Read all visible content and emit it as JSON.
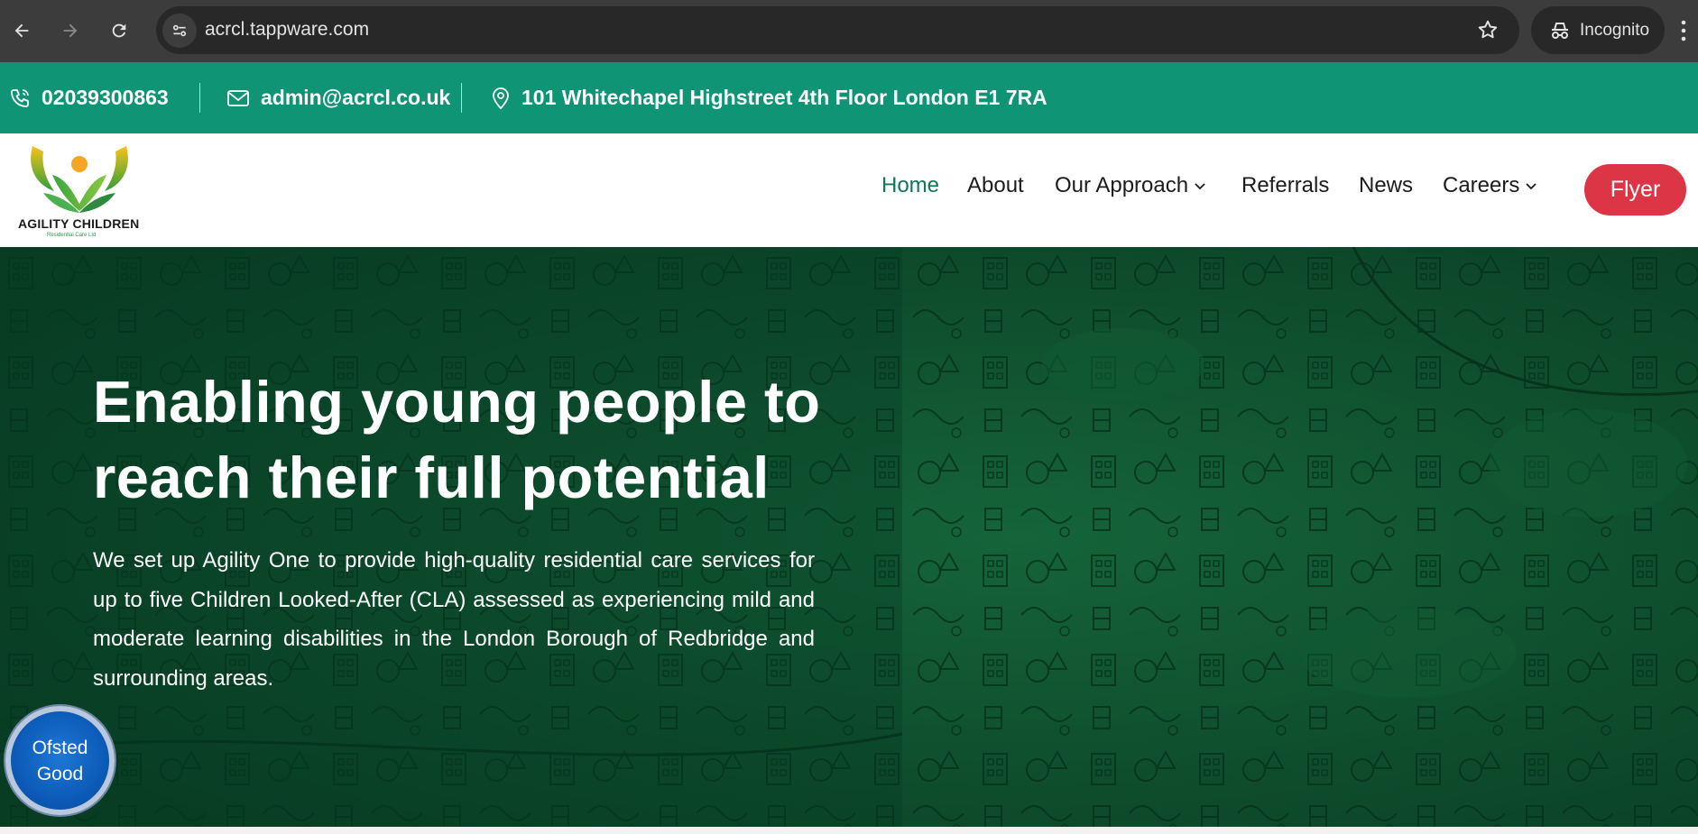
{
  "browser": {
    "url": "acrcl.tappware.com",
    "incognito_label": "Incognito",
    "icons": [
      "back-arrow-icon",
      "forward-arrow-icon",
      "reload-icon",
      "site-info-icon",
      "star-icon",
      "incognito-icon",
      "more-vert-icon"
    ]
  },
  "contact": {
    "phone": "02039300863",
    "email": "admin@acrcl.co.uk",
    "address": "101 Whitechapel Highstreet 4th Floor London E1 7RA",
    "icons": [
      "phone-icon",
      "mail-icon",
      "location-pin-icon"
    ]
  },
  "header": {
    "logo_title": "AGILITY CHILDREN",
    "logo_subtitle": "Residential Care Ltd",
    "nav": {
      "home": "Home",
      "about": "About",
      "approach": "Our Approach",
      "referrals": "Referrals",
      "news": "News",
      "careers": "Careers"
    },
    "flyer_label": "Flyer"
  },
  "hero": {
    "title_line1": "Enabling young people to",
    "title_line2": "reach their full potential",
    "description": "We set up Agility One to provide high-quality residential care services for up to five Children Looked-After (CLA) assessed as experiencing mild and moderate learning disabilities in the London Borough of Redbridge and surrounding areas."
  },
  "badge": {
    "line1": "Ofsted",
    "line2": "Good"
  },
  "colors": {
    "chrome": "#3c3c3c",
    "info_bar": "#0f9476",
    "hero": "#0b4a2a",
    "active_nav": "#0e7a53",
    "flyer_button": "#dc3545",
    "badge": "#0c5bb8"
  }
}
